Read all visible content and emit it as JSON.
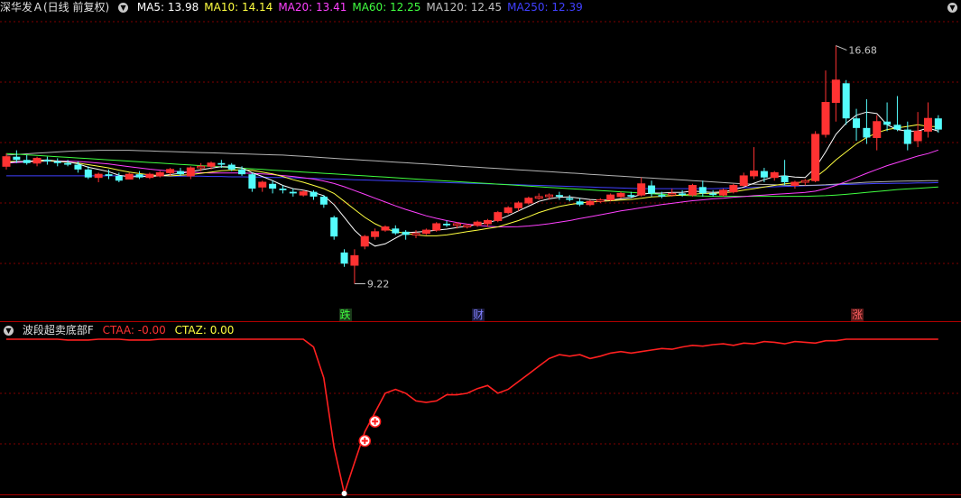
{
  "main_header": {
    "title": "深华发Ａ(日线 前复权)",
    "ma": [
      {
        "label": "MA5: 13.98",
        "color": "#ffffff"
      },
      {
        "label": "MA10: 14.14",
        "color": "#ffff40"
      },
      {
        "label": "MA20: 13.41",
        "color": "#ff40ff"
      },
      {
        "label": "MA60: 12.25",
        "color": "#40ff40"
      },
      {
        "label": "MA120: 12.45",
        "color": "#c0c0c0"
      },
      {
        "label": "MA250: 12.39",
        "color": "#4040ff"
      }
    ]
  },
  "annotations": {
    "high_label": "16.68",
    "low_label": "9.22",
    "tags": [
      {
        "text": "跌",
        "color": "#40ff40",
        "bg": "#1a3a1a"
      },
      {
        "text": "财",
        "color": "#8080ff",
        "bg": "#1a1a3a"
      },
      {
        "text": "涨",
        "color": "#ff6060",
        "bg": "#5a1a1a"
      }
    ]
  },
  "indicator_header": {
    "title": "波段超卖底部F",
    "ctaa": "CTAA: -0.00",
    "ctaz": "CTAZ: 0.00"
  },
  "colors": {
    "up": "#ff3232",
    "down": "#54fcfc",
    "grid": "#7f0000",
    "indicator_line": "#ff2020"
  },
  "chart_data": {
    "type": "candlestick",
    "candles": [
      [
        12.9,
        13.3,
        12.8,
        13.2
      ],
      [
        13.2,
        13.4,
        13.0,
        13.1
      ],
      [
        13.1,
        13.25,
        12.95,
        13.0
      ],
      [
        13.0,
        13.2,
        12.9,
        13.15
      ],
      [
        13.1,
        13.2,
        12.95,
        13.05
      ],
      [
        13.05,
        13.15,
        12.9,
        13.0
      ],
      [
        13.0,
        13.1,
        12.9,
        12.95
      ],
      [
        12.95,
        13.05,
        12.7,
        12.8
      ],
      [
        12.8,
        12.9,
        12.5,
        12.55
      ],
      [
        12.55,
        12.7,
        12.4,
        12.65
      ],
      [
        12.65,
        12.8,
        12.5,
        12.6
      ],
      [
        12.6,
        12.7,
        12.4,
        12.45
      ],
      [
        12.5,
        12.7,
        12.5,
        12.65
      ],
      [
        12.65,
        12.75,
        12.5,
        12.55
      ],
      [
        12.55,
        12.7,
        12.5,
        12.65
      ],
      [
        12.6,
        12.75,
        12.55,
        12.7
      ],
      [
        12.7,
        12.85,
        12.6,
        12.8
      ],
      [
        12.75,
        12.85,
        12.6,
        12.65
      ],
      [
        12.6,
        12.9,
        12.5,
        12.85
      ],
      [
        12.85,
        13.0,
        12.75,
        12.9
      ],
      [
        12.9,
        13.05,
        12.8,
        13.0
      ],
      [
        13.0,
        13.1,
        12.85,
        12.95
      ],
      [
        12.95,
        13.0,
        12.75,
        12.8
      ],
      [
        12.8,
        12.9,
        12.6,
        12.65
      ],
      [
        12.65,
        12.7,
        12.1,
        12.2
      ],
      [
        12.25,
        12.45,
        12.1,
        12.4
      ],
      [
        12.35,
        12.45,
        12.05,
        12.2
      ],
      [
        12.2,
        12.3,
        12.05,
        12.15
      ],
      [
        12.1,
        12.2,
        11.95,
        12.05
      ],
      [
        12.0,
        12.15,
        11.95,
        12.1
      ],
      [
        12.1,
        12.15,
        11.85,
        11.95
      ],
      [
        11.95,
        12.0,
        11.6,
        11.7
      ],
      [
        11.3,
        11.35,
        10.6,
        10.7
      ],
      [
        10.2,
        10.3,
        9.75,
        9.85
      ],
      [
        9.8,
        10.3,
        9.22,
        10.1
      ],
      [
        10.4,
        10.75,
        10.3,
        10.7
      ],
      [
        10.7,
        10.95,
        10.6,
        10.85
      ],
      [
        10.9,
        11.05,
        10.85,
        11.0
      ],
      [
        10.95,
        11.05,
        10.75,
        10.8
      ],
      [
        10.85,
        10.9,
        10.6,
        10.75
      ],
      [
        10.75,
        10.9,
        10.65,
        10.8
      ],
      [
        10.8,
        10.95,
        10.75,
        10.9
      ],
      [
        10.9,
        11.15,
        10.85,
        11.1
      ],
      [
        11.1,
        11.2,
        11.0,
        11.05
      ],
      [
        11.05,
        11.15,
        10.95,
        11.1
      ],
      [
        11.0,
        11.1,
        10.95,
        11.05
      ],
      [
        11.05,
        11.2,
        11.0,
        11.15
      ],
      [
        11.1,
        11.25,
        11.0,
        11.2
      ],
      [
        11.2,
        11.5,
        11.15,
        11.45
      ],
      [
        11.45,
        11.65,
        11.4,
        11.6
      ],
      [
        11.6,
        11.8,
        11.5,
        11.75
      ],
      [
        11.75,
        11.95,
        11.7,
        11.9
      ],
      [
        11.9,
        12.05,
        11.85,
        11.95
      ],
      [
        11.95,
        12.05,
        11.85,
        12.0
      ],
      [
        12.0,
        12.1,
        11.85,
        11.95
      ],
      [
        11.9,
        12.0,
        11.8,
        11.85
      ],
      [
        11.8,
        11.9,
        11.65,
        11.7
      ],
      [
        11.7,
        11.85,
        11.65,
        11.8
      ],
      [
        11.8,
        11.9,
        11.75,
        11.85
      ],
      [
        11.85,
        12.05,
        11.8,
        12.0
      ],
      [
        11.95,
        12.1,
        11.9,
        12.05
      ],
      [
        12.0,
        12.1,
        11.9,
        11.95
      ],
      [
        12.0,
        12.55,
        11.95,
        12.35
      ],
      [
        12.3,
        12.45,
        11.95,
        12.05
      ],
      [
        12.0,
        12.1,
        11.9,
        11.95
      ],
      [
        12.0,
        12.2,
        11.95,
        12.05
      ],
      [
        12.05,
        12.15,
        11.95,
        12.0
      ],
      [
        12.0,
        12.35,
        11.95,
        12.3
      ],
      [
        12.25,
        12.45,
        11.95,
        12.05
      ],
      [
        12.05,
        12.15,
        11.95,
        12.0
      ],
      [
        12.0,
        12.2,
        11.95,
        12.15
      ],
      [
        12.1,
        12.35,
        12.05,
        12.3
      ],
      [
        12.3,
        12.7,
        12.25,
        12.6
      ],
      [
        12.6,
        13.5,
        12.5,
        12.75
      ],
      [
        12.75,
        12.85,
        12.4,
        12.55
      ],
      [
        12.55,
        12.75,
        12.45,
        12.7
      ],
      [
        12.6,
        13.1,
        12.3,
        12.4
      ],
      [
        12.3,
        12.45,
        12.2,
        12.4
      ],
      [
        12.4,
        12.5,
        12.3,
        12.45
      ],
      [
        12.45,
        14.0,
        12.4,
        13.9
      ],
      [
        13.9,
        15.9,
        13.8,
        14.9
      ],
      [
        14.9,
        16.68,
        14.3,
        15.6
      ],
      [
        15.5,
        15.6,
        14.2,
        14.4
      ],
      [
        14.4,
        14.7,
        13.7,
        14.1
      ],
      [
        14.1,
        15.0,
        13.6,
        13.8
      ],
      [
        13.8,
        14.5,
        13.4,
        14.3
      ],
      [
        14.3,
        14.9,
        14.0,
        14.2
      ],
      [
        14.2,
        15.1,
        14.0,
        14.05
      ],
      [
        14.05,
        14.3,
        13.4,
        13.6
      ],
      [
        13.7,
        14.6,
        13.5,
        14.0
      ],
      [
        14.0,
        14.9,
        13.8,
        14.4
      ],
      [
        14.4,
        14.5,
        13.95,
        14.05
      ]
    ],
    "ma5": [
      13.0,
      13.05,
      13.05,
      13.08,
      13.1,
      13.06,
      13.04,
      12.98,
      12.87,
      12.8,
      12.73,
      12.62,
      12.57,
      12.58,
      12.58,
      12.6,
      12.64,
      12.68,
      12.73,
      12.79,
      12.84,
      12.89,
      12.88,
      12.85,
      12.7,
      12.58,
      12.45,
      12.3,
      12.2,
      12.15,
      12.08,
      11.98,
      11.7,
      11.3,
      10.9,
      10.6,
      10.4,
      10.47,
      10.65,
      10.82,
      10.84,
      10.86,
      10.9,
      10.93,
      10.98,
      11.02,
      11.08,
      11.14,
      11.22,
      11.35,
      11.5,
      11.65,
      11.8,
      11.88,
      11.93,
      11.94,
      11.9,
      11.86,
      11.84,
      11.84,
      11.88,
      11.92,
      12.02,
      12.06,
      12.06,
      12.08,
      12.08,
      12.13,
      12.1,
      12.08,
      12.1,
      12.16,
      12.25,
      12.37,
      12.48,
      12.58,
      12.6,
      12.56,
      12.55,
      12.85,
      13.35,
      13.9,
      14.25,
      14.5,
      14.6,
      14.55,
      14.2,
      14.05,
      14.0,
      14.0,
      14.1,
      14.0
    ],
    "ma10": [
      13.05,
      13.05,
      13.05,
      13.06,
      13.07,
      13.05,
      13.03,
      13.0,
      12.95,
      12.9,
      12.85,
      12.78,
      12.72,
      12.67,
      12.63,
      12.61,
      12.6,
      12.62,
      12.64,
      12.68,
      12.72,
      12.76,
      12.78,
      12.79,
      12.77,
      12.72,
      12.66,
      12.58,
      12.48,
      12.4,
      12.3,
      12.2,
      12.05,
      11.8,
      11.55,
      11.3,
      11.1,
      10.95,
      10.85,
      10.8,
      10.75,
      10.72,
      10.72,
      10.75,
      10.8,
      10.85,
      10.9,
      10.95,
      11.0,
      11.1,
      11.2,
      11.32,
      11.45,
      11.55,
      11.64,
      11.7,
      11.75,
      11.78,
      11.8,
      11.82,
      11.84,
      11.86,
      11.9,
      11.94,
      11.96,
      11.98,
      12.0,
      12.02,
      12.05,
      12.05,
      12.07,
      12.1,
      12.15,
      12.2,
      12.25,
      12.3,
      12.35,
      12.38,
      12.42,
      12.55,
      12.8,
      13.1,
      13.35,
      13.6,
      13.8,
      13.95,
      14.05,
      14.1,
      14.15,
      14.2,
      14.15,
      14.14
    ],
    "ma20": [
      13.0,
      13.02,
      13.04,
      13.05,
      13.06,
      13.06,
      13.06,
      13.05,
      13.03,
      13.0,
      12.97,
      12.93,
      12.89,
      12.85,
      12.81,
      12.78,
      12.75,
      12.73,
      12.71,
      12.7,
      12.69,
      12.69,
      12.69,
      12.69,
      12.68,
      12.66,
      12.64,
      12.61,
      12.58,
      12.54,
      12.5,
      12.44,
      12.36,
      12.26,
      12.14,
      12.02,
      11.9,
      11.78,
      11.66,
      11.55,
      11.45,
      11.35,
      11.27,
      11.2,
      11.14,
      11.09,
      11.05,
      11.02,
      11.0,
      11.0,
      11.01,
      11.03,
      11.06,
      11.1,
      11.15,
      11.2,
      11.26,
      11.32,
      11.38,
      11.44,
      11.5,
      11.55,
      11.6,
      11.65,
      11.7,
      11.74,
      11.78,
      11.82,
      11.85,
      11.88,
      11.9,
      11.93,
      11.95,
      11.98,
      12.0,
      12.02,
      12.04,
      12.06,
      12.08,
      12.12,
      12.2,
      12.3,
      12.42,
      12.55,
      12.68,
      12.8,
      12.92,
      13.02,
      13.12,
      13.22,
      13.3,
      13.41
    ],
    "ma60": [
      13.3,
      13.28,
      13.26,
      13.24,
      13.22,
      13.2,
      13.18,
      13.16,
      13.14,
      13.12,
      13.1,
      13.08,
      13.06,
      13.04,
      13.02,
      13.0,
      12.98,
      12.96,
      12.94,
      12.92,
      12.9,
      12.88,
      12.86,
      12.84,
      12.82,
      12.8,
      12.78,
      12.76,
      12.74,
      12.72,
      12.7,
      12.68,
      12.66,
      12.64,
      12.62,
      12.6,
      12.58,
      12.56,
      12.54,
      12.52,
      12.5,
      12.48,
      12.46,
      12.44,
      12.42,
      12.4,
      12.38,
      12.36,
      12.34,
      12.32,
      12.3,
      12.28,
      12.26,
      12.24,
      12.22,
      12.2,
      12.18,
      12.16,
      12.14,
      12.12,
      12.1,
      12.08,
      12.06,
      12.04,
      12.02,
      12.0,
      11.99,
      11.98,
      11.97,
      11.96,
      11.96,
      11.96,
      11.96,
      11.96,
      11.96,
      11.96,
      11.96,
      11.96,
      11.96,
      11.97,
      11.98,
      12.0,
      12.02,
      12.05,
      12.08,
      12.11,
      12.14,
      12.17,
      12.19,
      12.21,
      12.23,
      12.25
    ],
    "ma120": [
      13.25,
      13.27,
      13.29,
      13.31,
      13.33,
      13.35,
      13.37,
      13.38,
      13.39,
      13.4,
      13.4,
      13.4,
      13.4,
      13.39,
      13.38,
      13.37,
      13.36,
      13.35,
      13.34,
      13.33,
      13.32,
      13.31,
      13.3,
      13.29,
      13.28,
      13.27,
      13.26,
      13.25,
      13.23,
      13.21,
      13.19,
      13.17,
      13.15,
      13.13,
      13.11,
      13.09,
      13.07,
      13.05,
      13.03,
      13.01,
      12.99,
      12.97,
      12.95,
      12.93,
      12.91,
      12.89,
      12.87,
      12.85,
      12.83,
      12.81,
      12.79,
      12.77,
      12.75,
      12.73,
      12.71,
      12.69,
      12.67,
      12.65,
      12.63,
      12.61,
      12.59,
      12.57,
      12.55,
      12.53,
      12.51,
      12.49,
      12.47,
      12.45,
      12.43,
      12.41,
      12.39,
      12.37,
      12.35,
      12.34,
      12.33,
      12.32,
      12.31,
      12.3,
      12.3,
      12.31,
      12.32,
      12.34,
      12.36,
      12.38,
      12.4,
      12.41,
      12.42,
      12.43,
      12.44,
      12.44,
      12.45,
      12.45
    ],
    "ma250": [
      12.6,
      12.6,
      12.6,
      12.6,
      12.6,
      12.6,
      12.6,
      12.6,
      12.6,
      12.6,
      12.6,
      12.6,
      12.6,
      12.6,
      12.6,
      12.6,
      12.59,
      12.59,
      12.59,
      12.59,
      12.58,
      12.58,
      12.57,
      12.57,
      12.56,
      12.56,
      12.55,
      12.55,
      12.54,
      12.53,
      12.52,
      12.51,
      12.5,
      12.49,
      12.48,
      12.47,
      12.46,
      12.45,
      12.44,
      12.43,
      12.42,
      12.41,
      12.4,
      12.39,
      12.38,
      12.37,
      12.36,
      12.35,
      12.34,
      12.33,
      12.32,
      12.31,
      12.3,
      12.29,
      12.28,
      12.27,
      12.26,
      12.25,
      12.24,
      12.23,
      12.22,
      12.21,
      12.2,
      12.2,
      12.2,
      12.2,
      12.2,
      12.2,
      12.2,
      12.2,
      12.21,
      12.22,
      12.23,
      12.24,
      12.25,
      12.26,
      12.27,
      12.28,
      12.29,
      12.3,
      12.31,
      12.32,
      12.33,
      12.34,
      12.35,
      12.36,
      12.36,
      12.37,
      12.37,
      12.38,
      12.38,
      12.39
    ],
    "indicator": [
      1.0,
      1.0,
      1.0,
      1.0,
      1.0,
      1.0,
      0.99,
      0.99,
      0.99,
      1.0,
      1.0,
      1.0,
      0.99,
      0.99,
      0.99,
      1.0,
      1.0,
      1.0,
      1.0,
      1.0,
      1.0,
      1.0,
      1.0,
      1.0,
      1.0,
      1.0,
      1.0,
      1.0,
      1.0,
      1.0,
      0.9,
      0.5,
      -0.4,
      -1.0,
      -0.6,
      -0.2,
      0.05,
      0.3,
      0.35,
      0.3,
      0.2,
      0.18,
      0.2,
      0.28,
      0.28,
      0.3,
      0.36,
      0.4,
      0.3,
      0.35,
      0.45,
      0.55,
      0.65,
      0.75,
      0.8,
      0.78,
      0.8,
      0.75,
      0.78,
      0.82,
      0.84,
      0.82,
      0.84,
      0.86,
      0.88,
      0.87,
      0.9,
      0.92,
      0.91,
      0.93,
      0.94,
      0.92,
      0.95,
      0.94,
      0.97,
      0.96,
      0.94,
      0.97,
      0.96,
      0.95,
      0.98,
      0.98,
      1.0,
      1.0,
      1.0,
      1.0,
      1.0,
      1.0,
      1.0,
      1.0,
      1.0,
      1.0
    ],
    "indicator_scale": [
      -1.0,
      1.0
    ],
    "signal_points": [
      35,
      36
    ],
    "price_range": [
      8.5,
      17.6
    ],
    "tag_index": [
      33,
      46,
      83
    ],
    "high_index": 81,
    "low_index": 34
  }
}
